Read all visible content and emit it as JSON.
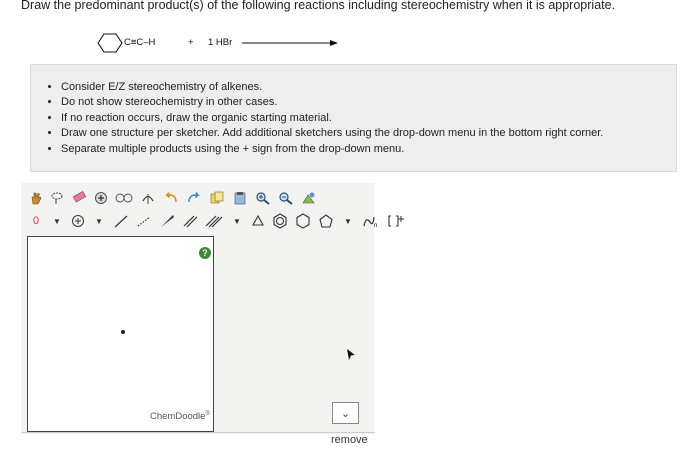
{
  "question": "Draw the predominant product(s) of the following reactions including stereochemistry when it is appropriate.",
  "reaction": {
    "substituent": "C≡C–H",
    "plus": "+",
    "reagent": "1 HBr"
  },
  "instructions": [
    "Consider E/Z stereochemistry of alkenes.",
    "Do not show stereochemistry in other cases.",
    "If no reaction occurs, draw the organic starting material.",
    "Draw one structure per sketcher. Add additional sketchers using the drop-down menu in the bottom right corner.",
    "Separate multiple products using the + sign from the drop-down menu."
  ],
  "sketcher": {
    "brand": "ChemDoodle",
    "brand_mark": "®",
    "toolbar_text": {
      "zero": "0",
      "help": "?"
    }
  },
  "remove_label": "remove",
  "colors": {
    "instruction_bg": "#eeeeee",
    "sketcher_bg": "#f3f3f1",
    "help_green": "#3a8a3a"
  }
}
